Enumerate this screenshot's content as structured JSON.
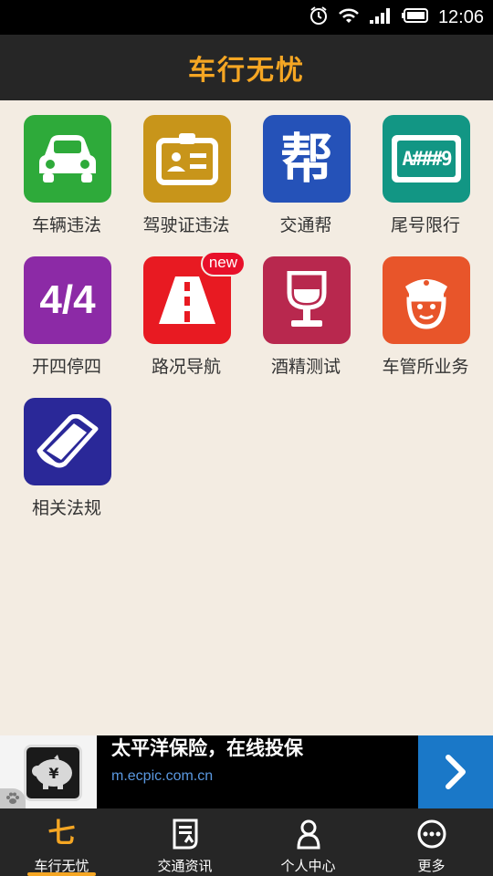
{
  "status_bar": {
    "time": "12:06"
  },
  "header": {
    "title": "车行无忧"
  },
  "colors": {
    "accent": "#f5a623",
    "header_bg": "#262626",
    "page_bg": "#f3ece2"
  },
  "grid": {
    "items": [
      {
        "label": "车辆违法",
        "icon": "car-icon",
        "color": "#2eaa3a"
      },
      {
        "label": "驾驶证违法",
        "icon": "license-icon",
        "color": "#c8951a"
      },
      {
        "label": "交通帮",
        "icon": "help-char-icon",
        "glyph": "帮",
        "color": "#2552b8"
      },
      {
        "label": "尾号限行",
        "icon": "plate-icon",
        "glyph": "A###9",
        "color": "#129684"
      },
      {
        "label": "开四停四",
        "icon": "four-four-icon",
        "glyph": "4/4",
        "color": "#8c2aa6"
      },
      {
        "label": "路况导航",
        "icon": "road-icon",
        "color": "#e81a22",
        "badge": "new"
      },
      {
        "label": "酒精测试",
        "icon": "wine-icon",
        "color": "#b8284e"
      },
      {
        "label": "车管所业务",
        "icon": "police-icon",
        "color": "#e8552a"
      },
      {
        "label": "相关法规",
        "icon": "book-icon",
        "color": "#2a2898"
      }
    ]
  },
  "ad": {
    "headline": "太平洋保险，在线投保",
    "url": "m.ecpic.com.cn",
    "yen": "¥"
  },
  "tabbar": {
    "tabs": [
      {
        "label": "车行无忧",
        "icon": "home-logo-icon",
        "glyph": "七"
      },
      {
        "label": "交通资讯",
        "icon": "news-icon"
      },
      {
        "label": "个人中心",
        "icon": "person-icon"
      },
      {
        "label": "更多",
        "icon": "more-icon"
      }
    ]
  }
}
